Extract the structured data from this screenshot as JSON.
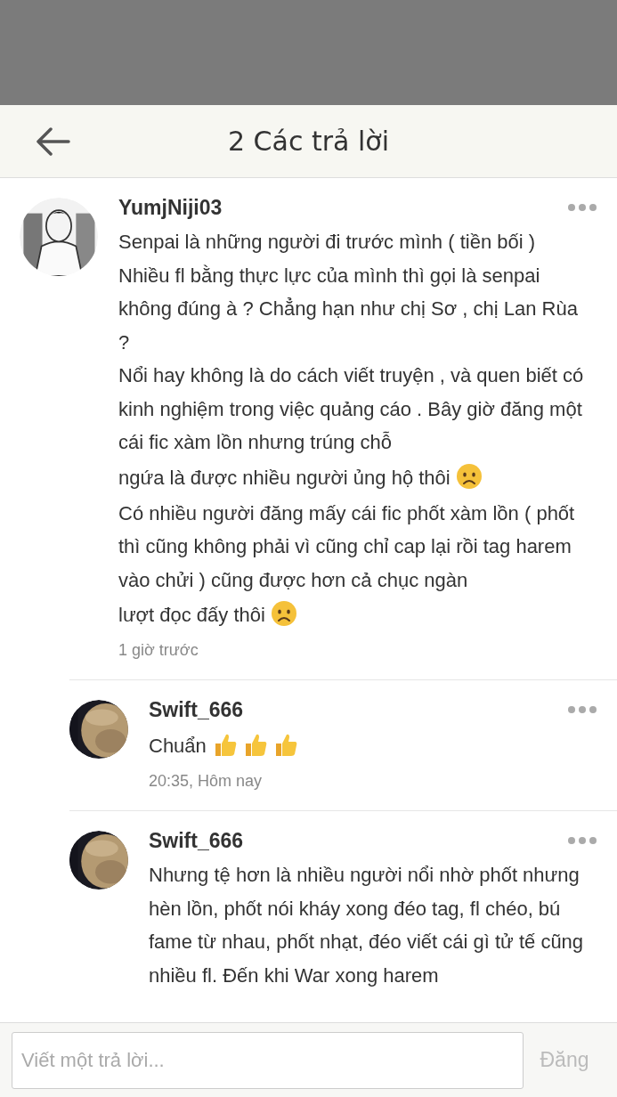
{
  "header": {
    "title": "2 Các trả lời"
  },
  "comments": [
    {
      "author": "YumjNiji03",
      "time": "1 giờ trước",
      "reply": false,
      "body": [
        {
          "text": "Senpai là những người đi trước mình ( tiền bối )\nNhiều fl bằng thực lực của mình thì gọi là senpai không đúng à ? Chẳng hạn như chị Sơ , chị Lan Rùa ?\nNổi hay không là do cách viết truyện , và quen biết có kinh nghiệm trong việc quảng cáo . Bây giờ đăng một cái fic xàm lồn nhưng trúng chỗ"
        },
        {
          "text": "ngứa là được nhiều người ủng hộ thôi",
          "emoji": [
            {
              "kind": "worried"
            }
          ]
        },
        {
          "text": "Có nhiều người đăng mấy cái fic phốt xàm lồn ( phốt thì cũng không phải vì cũng chỉ cap lại rồi tag harem vào chửi ) cũng được hơn cả chục ngàn"
        },
        {
          "text": "lượt đọc đấy thôi",
          "emoji": [
            {
              "kind": "worried"
            }
          ]
        }
      ]
    },
    {
      "author": "Swift_666",
      "time": "20:35, Hôm nay",
      "reply": true,
      "body": [
        {
          "text": "Chuẩn",
          "emoji": [
            {
              "kind": "thumbsup"
            },
            {
              "kind": "thumbsup"
            },
            {
              "kind": "thumbsup"
            }
          ]
        }
      ]
    },
    {
      "author": "Swift_666",
      "reply": true,
      "body": [
        {
          "text": "Nhưng tệ hơn là nhiều người nổi nhờ phốt nhưng hèn lồn, phốt nói kháy xong đéo tag, fl chéo, bú fame từ nhau, phốt nhạt, đéo viết cái gì tử tế cũng nhiều fl. Đến khi War xong harem"
        }
      ]
    }
  ],
  "composer": {
    "placeholder": "Viết một trả lời...",
    "button": "Đăng"
  }
}
